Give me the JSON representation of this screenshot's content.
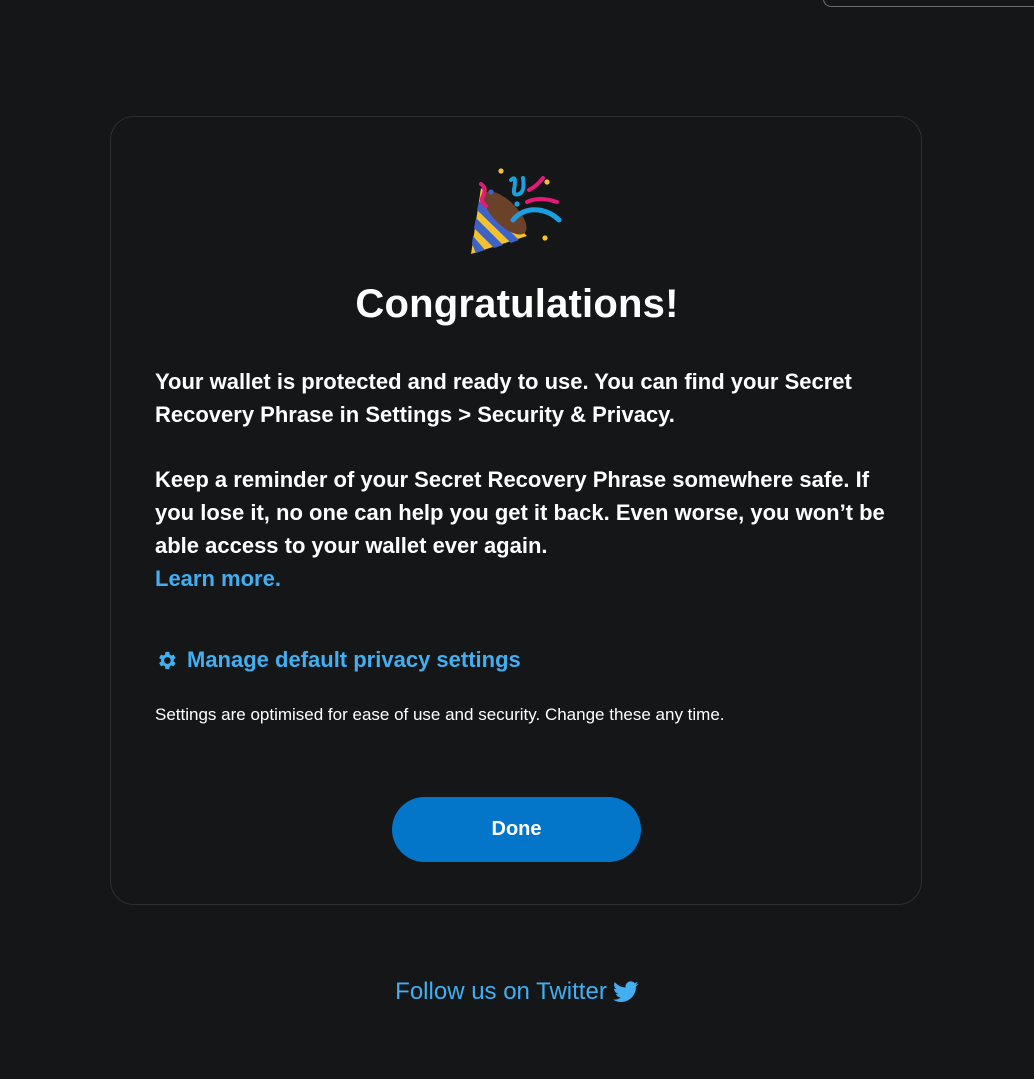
{
  "congrats": {
    "title": "Congratulations!",
    "p1_text": "Your wallet is protected and ready to use. You can find your Secret Recovery Phrase in ",
    "p1_strong": "Settings > Security & Privacy.",
    "p2_text": "Keep a reminder of your Secret Recovery Phrase somewhere safe. If you lose it, no one can help you get it back. Even worse, you won’t be able access to your wallet ever again.",
    "learn_more": "Learn more.",
    "manage_link": "Manage default privacy settings",
    "manage_hint": "Settings are optimised for ease of use and security. Change these any time.",
    "done_label": "Done"
  },
  "footer": {
    "follow_label": "Follow us on Twitter"
  },
  "icons": {
    "celebration": "party-popper-icon",
    "settings": "gear-icon",
    "twitter": "twitter-icon"
  },
  "colors": {
    "background": "#141618",
    "link": "#43aef0",
    "primary_button": "#0376c9",
    "card_border": "#2c2f33"
  }
}
